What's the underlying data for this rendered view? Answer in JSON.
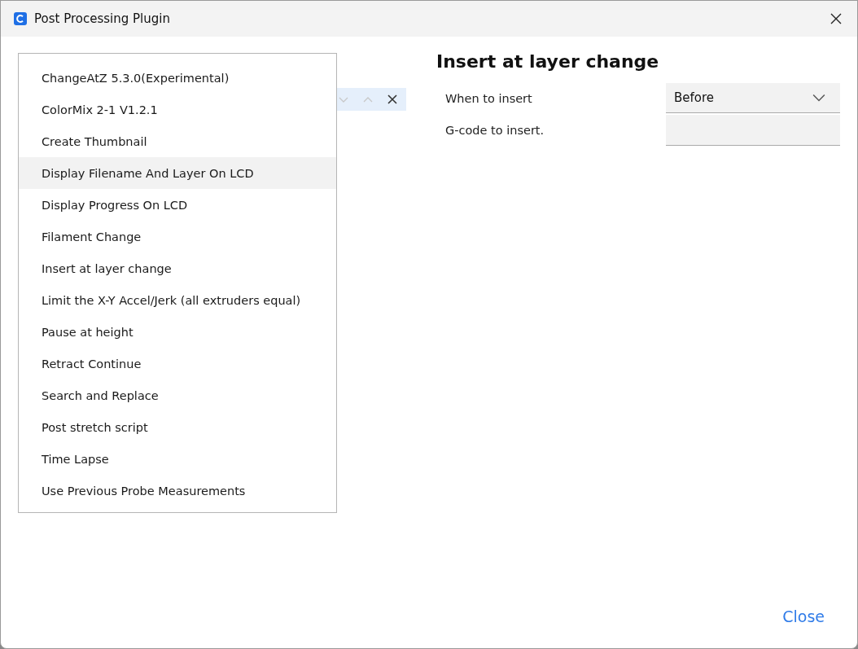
{
  "window": {
    "title": "Post Processing Plugin"
  },
  "script_list": {
    "rows": [
      {
        "selected": true
      }
    ]
  },
  "menu": {
    "items": [
      {
        "label": "ChangeAtZ 5.3.0(Experimental)",
        "highlighted": false
      },
      {
        "label": "ColorMix 2-1 V1.2.1",
        "highlighted": false
      },
      {
        "label": "Create Thumbnail",
        "highlighted": false
      },
      {
        "label": "Display Filename And Layer On LCD",
        "highlighted": true
      },
      {
        "label": "Display Progress On LCD",
        "highlighted": false
      },
      {
        "label": "Filament Change",
        "highlighted": false
      },
      {
        "label": "Insert at layer change",
        "highlighted": false
      },
      {
        "label": "Limit the X-Y Accel/Jerk (all extruders equal)",
        "highlighted": false
      },
      {
        "label": "Pause at height",
        "highlighted": false
      },
      {
        "label": "Retract Continue",
        "highlighted": false
      },
      {
        "label": "Search and Replace",
        "highlighted": false
      },
      {
        "label": "Post stretch script",
        "highlighted": false
      },
      {
        "label": "Time Lapse",
        "highlighted": false
      },
      {
        "label": "Use Previous Probe Measurements",
        "highlighted": false
      }
    ]
  },
  "settings": {
    "title": "Insert at layer change",
    "rows": [
      {
        "kind": "dropdown",
        "label": "When to insert",
        "value": "Before"
      },
      {
        "kind": "text",
        "label": "G-code to insert."
      }
    ]
  },
  "close_button": "Close"
}
